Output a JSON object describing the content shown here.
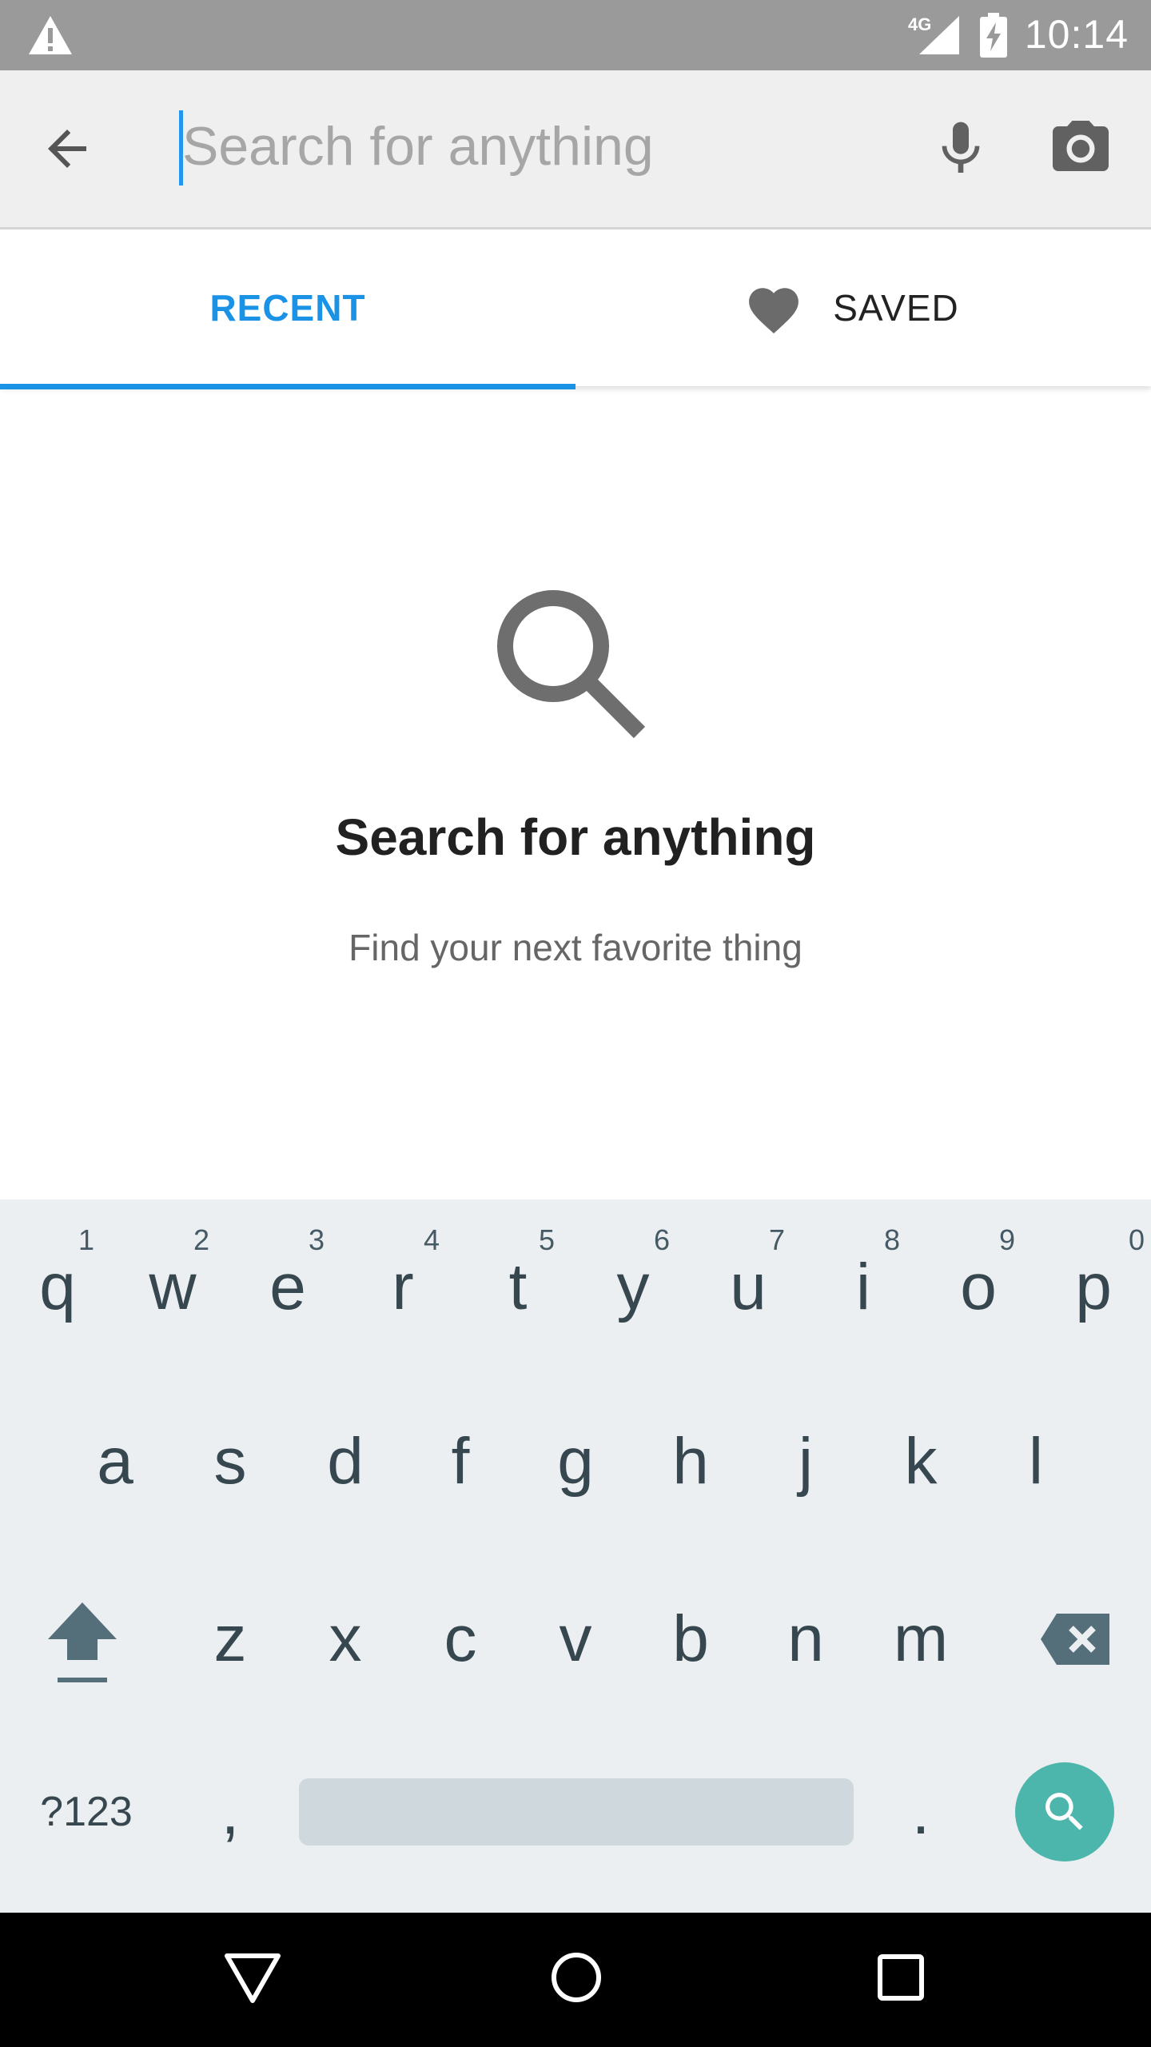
{
  "status_bar": {
    "time": "10:14",
    "network": "4G",
    "icons": [
      "warning-icon",
      "signal-icon",
      "battery-charging-icon"
    ]
  },
  "search": {
    "placeholder": "Search for anything",
    "value": "",
    "icons": [
      "back-arrow-icon",
      "microphone-icon",
      "camera-icon"
    ]
  },
  "tabs": {
    "recent": "RECENT",
    "saved": "SAVED",
    "active": "recent",
    "saved_icon": "heart-icon"
  },
  "empty_state": {
    "icon": "search-icon",
    "title": "Search for anything",
    "subtitle": "Find your next favorite thing"
  },
  "keyboard": {
    "row1": [
      {
        "key": "q",
        "hint": "1"
      },
      {
        "key": "w",
        "hint": "2"
      },
      {
        "key": "e",
        "hint": "3"
      },
      {
        "key": "r",
        "hint": "4"
      },
      {
        "key": "t",
        "hint": "5"
      },
      {
        "key": "y",
        "hint": "6"
      },
      {
        "key": "u",
        "hint": "7"
      },
      {
        "key": "i",
        "hint": "8"
      },
      {
        "key": "o",
        "hint": "9"
      },
      {
        "key": "p",
        "hint": "0"
      }
    ],
    "row2": [
      "a",
      "s",
      "d",
      "f",
      "g",
      "h",
      "j",
      "k",
      "l"
    ],
    "row3": [
      "z",
      "x",
      "c",
      "v",
      "b",
      "n",
      "m"
    ],
    "symbols_label": "?123",
    "comma": ",",
    "period": ".",
    "icons": [
      "shift-icon",
      "backspace-icon",
      "search-enter-icon"
    ]
  },
  "nav_bar": {
    "icons": [
      "back-triangle-icon",
      "home-circle-icon",
      "recents-square-icon"
    ]
  },
  "colors": {
    "accent": "#1a93e6",
    "status_bar": "#9a9a9a",
    "keyboard_bg": "#eceff1",
    "enter_key": "#4db6ac"
  }
}
